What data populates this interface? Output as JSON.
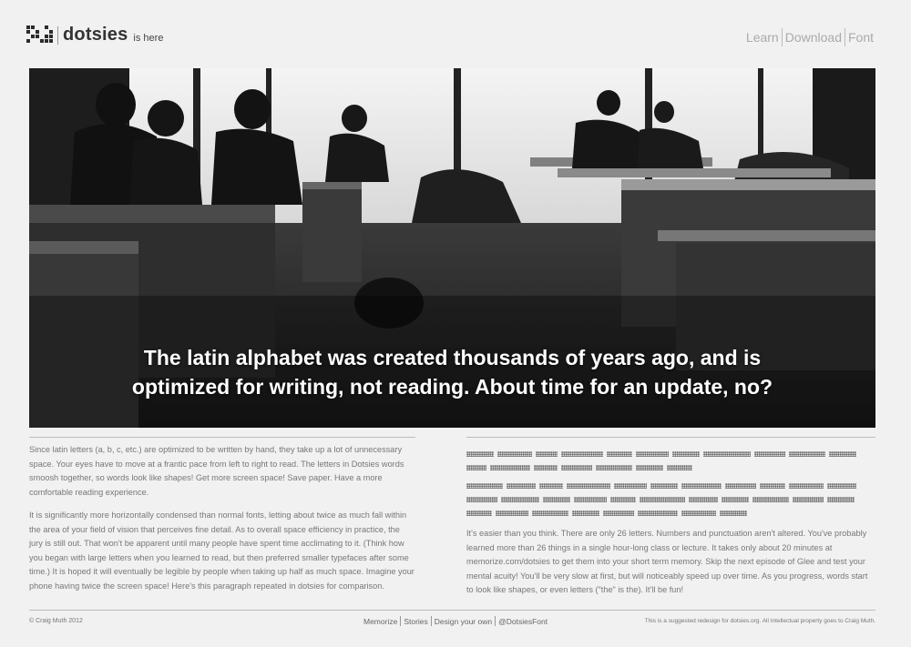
{
  "header": {
    "logo_icon": "dotsies-logo-icon",
    "brand": "dotsies",
    "tagline": "is here",
    "nav": [
      "Learn",
      "Download",
      "Font"
    ]
  },
  "hero": {
    "headline_1": "The latin alphabet was created thousands of years ago, and is",
    "headline_2": "optimized for writing, not reading. About time for an update, no?"
  },
  "left": {
    "p1": "Since latin letters (a, b, c, etc.) are optimized to be written by hand, they take up a lot of unnecessary space. Your eyes have to move at a frantic pace from left to right to read. The letters in Dotsies words smoosh together, so words look like shapes! Get more screen space! Save paper. Have a more comfortable reading experience.",
    "p2": "It is significantly more horizontally condensed than normal fonts, letting about twice as much fall within the area of your field of vision that perceives fine detail. As to overall space efficiency in practice, the jury is still out. That won't be apparent until many people have spent time acclimating to it. (Think how you began with large letters when you learned to read, but then preferred smaller typefaces after some time.) It is hoped it will eventually be legible by people when taking up half as much space. Imagine your phone having twice the screen space! Here's this paragraph repeated in dotsies for comparison."
  },
  "right": {
    "p3": "It's easier than you think. There are only 26 letters. Numbers and punctuation aren't altered. You've probably learned more than 26 things in a single hour-long class or lecture. It takes only about 20 minutes at memorize.com/dotsies to get them into your short term memory. Skip the next episode of Glee and test your mental acuity! You'll be very slow at first, but will noticeably speed up over time. As you progress, words start to look like shapes, or even letters (\"the\" is the). It'll be fun!"
  },
  "footer": {
    "copyright": "© Craig Muth 2012",
    "nav": [
      "Memorize",
      "Stories",
      "Design your own",
      "@DotsiesFont"
    ],
    "note": "This is a suggested redesign for dotsies.org. All Intellectual property goes to Craig Muth."
  }
}
